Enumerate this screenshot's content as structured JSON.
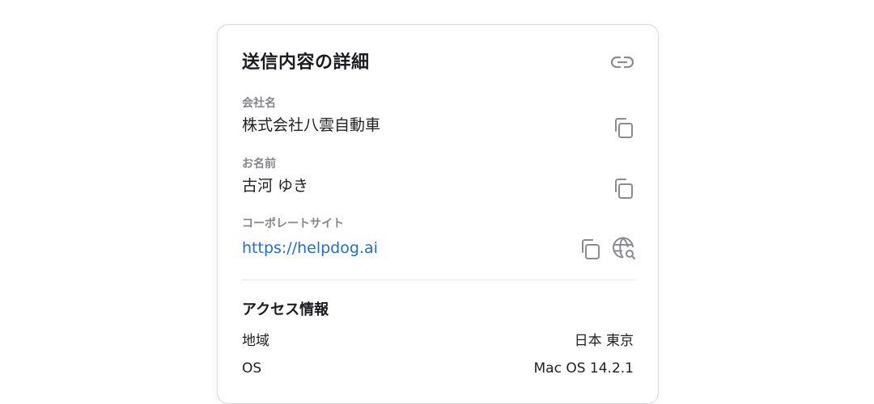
{
  "card": {
    "title": "送信内容の詳細",
    "fields": [
      {
        "label": "会社名",
        "value": "株式会社八雲自動車"
      },
      {
        "label": "お名前",
        "value": "古河 ゆき"
      },
      {
        "label": "コーポレートサイト",
        "value": "https://helpdog.ai"
      }
    ],
    "access": {
      "title": "アクセス情報",
      "rows": [
        {
          "label": "地域",
          "value": "日本 東京"
        },
        {
          "label": "OS",
          "value": "Mac OS 14.2.1"
        }
      ]
    }
  },
  "icons": {
    "header": "link-icon",
    "field_action": "copy-icon",
    "site_action": "globe-search-icon"
  },
  "colors": {
    "link": "#1a6fd4",
    "label_gray": "#85858d",
    "icon_gray": "#8a8a90",
    "border": "#d9d9de"
  }
}
